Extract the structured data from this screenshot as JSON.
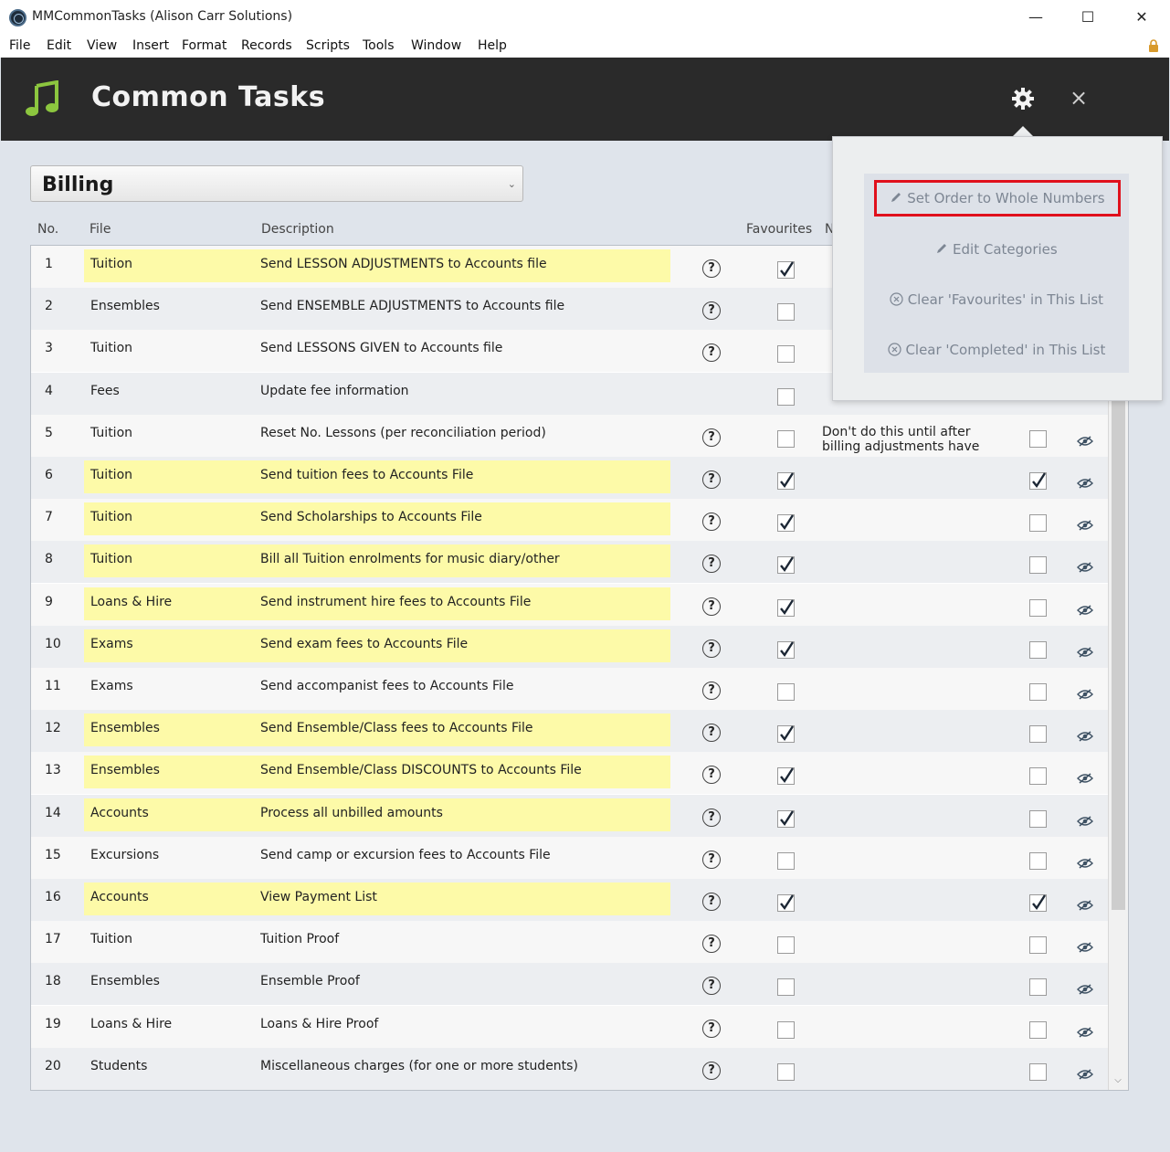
{
  "window": {
    "title": "MMCommonTasks (Alison Carr Solutions)",
    "minimize": "—",
    "maximize": "☐",
    "close": "✕"
  },
  "menu": [
    "File",
    "Edit",
    "View",
    "Insert",
    "Format",
    "Records",
    "Scripts",
    "Tools",
    "Window",
    "Help"
  ],
  "header": {
    "title": "Common Tasks",
    "close": "×"
  },
  "category": {
    "selected": "Billing"
  },
  "columns": {
    "no": "No.",
    "file": "File",
    "description": "Description",
    "favourites": "Favourites",
    "notes": "N"
  },
  "help_glyph": "?",
  "rows": [
    {
      "no": "1",
      "file": "Tuition",
      "desc": "Send LESSON ADJUSTMENTS to Accounts file",
      "fav": true,
      "hl": true,
      "done": false,
      "notes": ""
    },
    {
      "no": "2",
      "file": "Ensembles",
      "desc": "Send ENSEMBLE ADJUSTMENTS to Accounts file",
      "fav": false,
      "hl": false,
      "done": false,
      "notes": ""
    },
    {
      "no": "3",
      "file": "Tuition",
      "desc": "Send LESSONS GIVEN to Accounts file",
      "fav": false,
      "hl": false,
      "done": false,
      "notes": ""
    },
    {
      "no": "4",
      "file": "Fees",
      "desc": "Update fee information",
      "fav": false,
      "hl": false,
      "done": false,
      "notes": "",
      "nohelp": true
    },
    {
      "no": "5",
      "file": "Tuition",
      "desc": "Reset No. Lessons (per reconciliation period)",
      "fav": false,
      "hl": false,
      "done": false,
      "notes": "Don't do this until after billing adjustments have"
    },
    {
      "no": "6",
      "file": "Tuition",
      "desc": "Send tuition fees to Accounts File",
      "fav": true,
      "hl": true,
      "done": true,
      "notes": ""
    },
    {
      "no": "7",
      "file": "Tuition",
      "desc": "Send Scholarships to Accounts File",
      "fav": true,
      "hl": true,
      "done": false,
      "notes": ""
    },
    {
      "no": "8",
      "file": "Tuition",
      "desc": "Bill all Tuition enrolments for music diary/other",
      "fav": true,
      "hl": true,
      "done": false,
      "notes": ""
    },
    {
      "no": "9",
      "file": "Loans & Hire",
      "desc": "Send instrument hire fees to Accounts File",
      "fav": true,
      "hl": true,
      "done": false,
      "notes": ""
    },
    {
      "no": "10",
      "file": "Exams",
      "desc": "Send exam fees to Accounts File",
      "fav": true,
      "hl": true,
      "done": false,
      "notes": ""
    },
    {
      "no": "11",
      "file": "Exams",
      "desc": "Send accompanist fees to Accounts File",
      "fav": false,
      "hl": false,
      "done": false,
      "notes": ""
    },
    {
      "no": "12",
      "file": "Ensembles",
      "desc": "Send Ensemble/Class fees to Accounts File",
      "fav": true,
      "hl": true,
      "done": false,
      "notes": ""
    },
    {
      "no": "13",
      "file": "Ensembles",
      "desc": "Send Ensemble/Class DISCOUNTS to Accounts File",
      "fav": true,
      "hl": true,
      "done": false,
      "notes": ""
    },
    {
      "no": "14",
      "file": "Accounts",
      "desc": "Process all unbilled amounts",
      "fav": true,
      "hl": true,
      "done": false,
      "notes": ""
    },
    {
      "no": "15",
      "file": "Excursions",
      "desc": "Send camp or excursion fees to Accounts File",
      "fav": false,
      "hl": false,
      "done": false,
      "notes": ""
    },
    {
      "no": "16",
      "file": "Accounts",
      "desc": "View Payment List",
      "fav": true,
      "hl": true,
      "done": true,
      "notes": ""
    },
    {
      "no": "17",
      "file": "Tuition",
      "desc": "Tuition Proof",
      "fav": false,
      "hl": false,
      "done": false,
      "notes": ""
    },
    {
      "no": "18",
      "file": "Ensembles",
      "desc": "Ensemble Proof",
      "fav": false,
      "hl": false,
      "done": false,
      "notes": ""
    },
    {
      "no": "19",
      "file": "Loans & Hire",
      "desc": "Loans & Hire Proof",
      "fav": false,
      "hl": false,
      "done": false,
      "notes": ""
    },
    {
      "no": "20",
      "file": "Students",
      "desc": "Miscellaneous charges (for one or more students)",
      "fav": false,
      "hl": false,
      "done": false,
      "notes": ""
    }
  ],
  "settings_menu": {
    "items": [
      {
        "icon": "pencil-icon",
        "label": "Set Order to Whole Numbers"
      },
      {
        "icon": "pencil-icon",
        "label": "Edit Categories"
      },
      {
        "icon": "circle-x-icon",
        "label": "Clear 'Favourites' in This List"
      },
      {
        "icon": "circle-x-icon",
        "label": "Clear 'Completed' in This List"
      }
    ]
  },
  "colors": {
    "header_bg": "#2a2a2a",
    "accent_green": "#8cc63f",
    "highlight_yellow": "#fdfaa8",
    "selection_red": "#e0101c"
  }
}
